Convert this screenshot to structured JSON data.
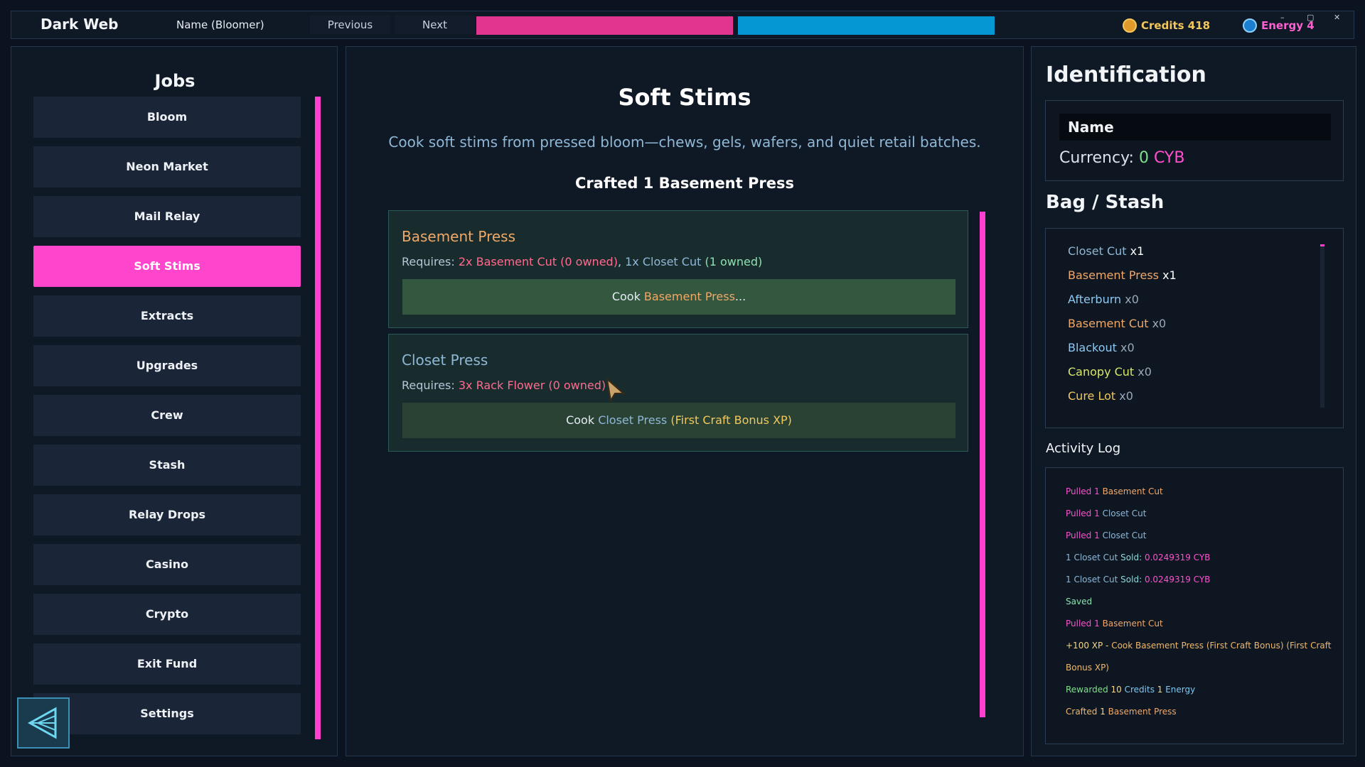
{
  "header": {
    "title": "Dark Web",
    "name": "Name (Bloomer)",
    "previous_label": "Previous",
    "next_label": "Next",
    "bar1_color": "#e1358f",
    "bar2_color": "#0596d4",
    "credits_label": "Credits 418",
    "energy_label": "Energy 4",
    "window_controls": [
      "–",
      "▢",
      "✕"
    ]
  },
  "sidebar": {
    "title": "Jobs",
    "items": [
      {
        "label": "Bloom"
      },
      {
        "label": "Neon Market"
      },
      {
        "label": "Mail Relay"
      },
      {
        "label": "Soft Stims",
        "active": true
      },
      {
        "label": "Extracts"
      },
      {
        "label": "Upgrades"
      },
      {
        "label": "Crew"
      },
      {
        "label": "Stash"
      },
      {
        "label": "Relay Drops"
      },
      {
        "label": "Casino"
      },
      {
        "label": "Crypto"
      },
      {
        "label": "Exit Fund"
      },
      {
        "label": "Settings"
      }
    ],
    "back_icon": "back-triangle-icon"
  },
  "main": {
    "title": "Soft Stims",
    "description": "Cook soft stims from pressed bloom—chews, gels, wafers, and quiet retail batches.",
    "crafted": "Crafted 1 Basement Press",
    "recipes": [
      {
        "name": "Basement Press",
        "name_color": "#f0a868",
        "req_prefix": "Requires: ",
        "req_a": "2x Basement Cut (0 owned)",
        "req_sep": ", ",
        "req_b_item": "1x Closet Cut",
        "req_b_owned": " (1 owned)",
        "button_prefix": "Cook ",
        "button_item": "Basement Press",
        "button_suffix": "..."
      },
      {
        "name": "Closet Press",
        "name_color": "#8fb7d6",
        "req_prefix": "Requires: ",
        "req_a": "3x Rack Flower (0 owned)",
        "button_prefix": "Cook ",
        "button_item": "Closet Press",
        "button_suffix": " (First Craft Bonus XP)"
      }
    ]
  },
  "identification": {
    "title": "Identification",
    "name": "Name",
    "currency_label": "Currency: ",
    "currency_value": "0",
    "currency_unit": "CYB"
  },
  "bag": {
    "title": "Bag / Stash",
    "items": [
      {
        "name": "Closet Cut",
        "qty": "x1",
        "color": "#8fb7d6"
      },
      {
        "name": "Basement Press",
        "qty": "x1",
        "color": "#f0a868"
      },
      {
        "name": "Afterburn",
        "qty": "x0",
        "color": "#8fc8f0"
      },
      {
        "name": "Basement Cut",
        "qty": "x0",
        "color": "#f0a868"
      },
      {
        "name": "Blackout",
        "qty": "x0",
        "color": "#8fc8f0"
      },
      {
        "name": "Canopy Cut",
        "qty": "x0",
        "color": "#d7e86a"
      },
      {
        "name": "Cure Lot",
        "qty": "x0",
        "color": "#f3c75b"
      }
    ]
  },
  "activity": {
    "title": "Activity Log",
    "lines": [
      [
        {
          "t": "Pulled ",
          "c": "#ff4fcf"
        },
        {
          "t": "1 ",
          "c": "#ff4fcf"
        },
        {
          "t": "Basement Cut",
          "c": "#f0a868"
        }
      ],
      [
        {
          "t": "Pulled ",
          "c": "#ff4fcf"
        },
        {
          "t": "1 ",
          "c": "#ff4fcf"
        },
        {
          "t": "Closet Cut",
          "c": "#8fb7d6"
        }
      ],
      [
        {
          "t": "Pulled ",
          "c": "#ff4fcf"
        },
        {
          "t": "1 ",
          "c": "#ff4fcf"
        },
        {
          "t": "Closet Cut",
          "c": "#8fb7d6"
        }
      ],
      [
        {
          "t": "1 Closet Cut",
          "c": "#8fb7d6"
        },
        {
          "t": " Sold: ",
          "c": "#8fd8d8"
        },
        {
          "t": "0.0249319 CYB",
          "c": "#ff4fcf"
        }
      ],
      [
        {
          "t": "1 Closet Cut",
          "c": "#8fb7d6"
        },
        {
          "t": " Sold: ",
          "c": "#8fd8d8"
        },
        {
          "t": "0.0249319 CYB",
          "c": "#ff4fcf"
        }
      ],
      [
        {
          "t": "Saved",
          "c": "#8fe0b0"
        }
      ],
      [
        {
          "t": "Pulled ",
          "c": "#ff4fcf"
        },
        {
          "t": "1 ",
          "c": "#ff4fcf"
        },
        {
          "t": "Basement Cut",
          "c": "#f0a868"
        }
      ],
      [
        {
          "t": "+100 XP - ",
          "c": "#f3d68a"
        },
        {
          "t": "Cook Basement Press (First Craft Bonus) (First Craft",
          "c": "#f0b86a"
        }
      ],
      [
        {
          "t": "Bonus XP)",
          "c": "#f0b86a"
        }
      ],
      [
        {
          "t": "Rewarded ",
          "c": "#7fe08a"
        },
        {
          "t": "10 ",
          "c": "#f3d68a"
        },
        {
          "t": "Credits ",
          "c": "#7fc8f0"
        },
        {
          "t": "1 ",
          "c": "#f3d68a"
        },
        {
          "t": "Energy",
          "c": "#7fc8f0"
        }
      ],
      [
        {
          "t": "Crafted ",
          "c": "#f0b86a"
        },
        {
          "t": "1 ",
          "c": "#f3d68a"
        },
        {
          "t": "Basement Press",
          "c": "#f0a868"
        }
      ]
    ]
  }
}
